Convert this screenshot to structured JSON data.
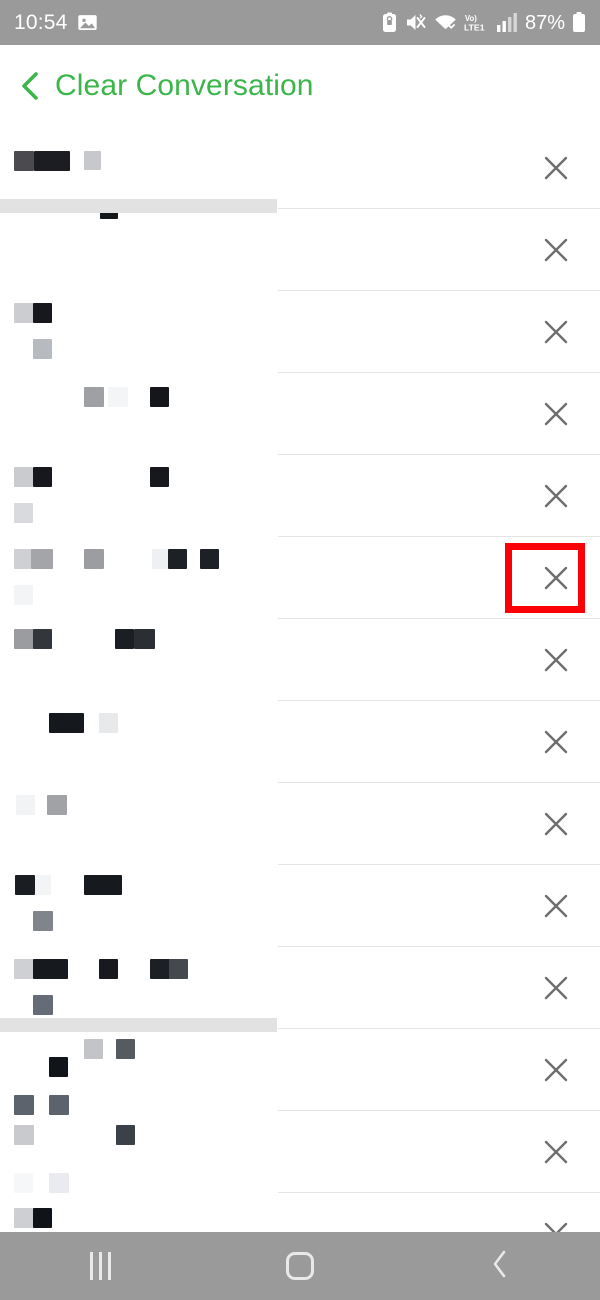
{
  "status_bar": {
    "time": "10:54",
    "battery_percent": "87%",
    "icons": [
      "gallery-image-icon",
      "battery-saver-icon",
      "mute-vibrate-icon",
      "wifi-icon",
      "volte-lte1-icon",
      "signal-bars-icon",
      "battery-icon"
    ],
    "network_label": "LTE1",
    "volte_label": "Vo))",
    "background": "#9a9a9a",
    "foreground": "#ffffff"
  },
  "header": {
    "title": "Clear Conversation",
    "back_icon": "back-chevron-icon",
    "accent_color": "#3cb54a"
  },
  "list": {
    "row_count": 14,
    "delete_icon": "close-x-icon",
    "delete_icon_color": "#6e6e6e",
    "divider_color": "#e4e4e4",
    "redacted": true,
    "rows": [
      {
        "id": "row-1",
        "label_redacted": true,
        "delete_label": "Delete conversation"
      },
      {
        "id": "row-2",
        "label_redacted": true,
        "delete_label": "Delete conversation"
      },
      {
        "id": "row-3",
        "label_redacted": true,
        "delete_label": "Delete conversation"
      },
      {
        "id": "row-4",
        "label_redacted": true,
        "delete_label": "Delete conversation"
      },
      {
        "id": "row-5",
        "label_redacted": true,
        "delete_label": "Delete conversation"
      },
      {
        "id": "row-6",
        "label_redacted": true,
        "delete_label": "Delete conversation",
        "highlighted": true
      },
      {
        "id": "row-7",
        "label_redacted": true,
        "delete_label": "Delete conversation"
      },
      {
        "id": "row-8",
        "label_redacted": true,
        "delete_label": "Delete conversation"
      },
      {
        "id": "row-9",
        "label_redacted": true,
        "delete_label": "Delete conversation"
      },
      {
        "id": "row-10",
        "label_redacted": true,
        "delete_label": "Delete conversation"
      },
      {
        "id": "row-11",
        "label_redacted": true,
        "delete_label": "Delete conversation"
      },
      {
        "id": "row-12",
        "label_redacted": true,
        "delete_label": "Delete conversation"
      },
      {
        "id": "row-13",
        "label_redacted": true,
        "delete_label": "Delete conversation"
      },
      {
        "id": "row-14",
        "label_redacted": true,
        "delete_label": "Delete conversation"
      }
    ]
  },
  "annotation": {
    "color": "#fb0007",
    "target": "delete-button-row-6",
    "shape": "rectangle"
  },
  "nav_bar": {
    "background": "#9a9a9a",
    "buttons": [
      {
        "name": "recents-button",
        "icon": "recents-icon"
      },
      {
        "name": "home-button",
        "icon": "home-icon"
      },
      {
        "name": "back-button",
        "icon": "back-chevron-icon"
      }
    ]
  }
}
